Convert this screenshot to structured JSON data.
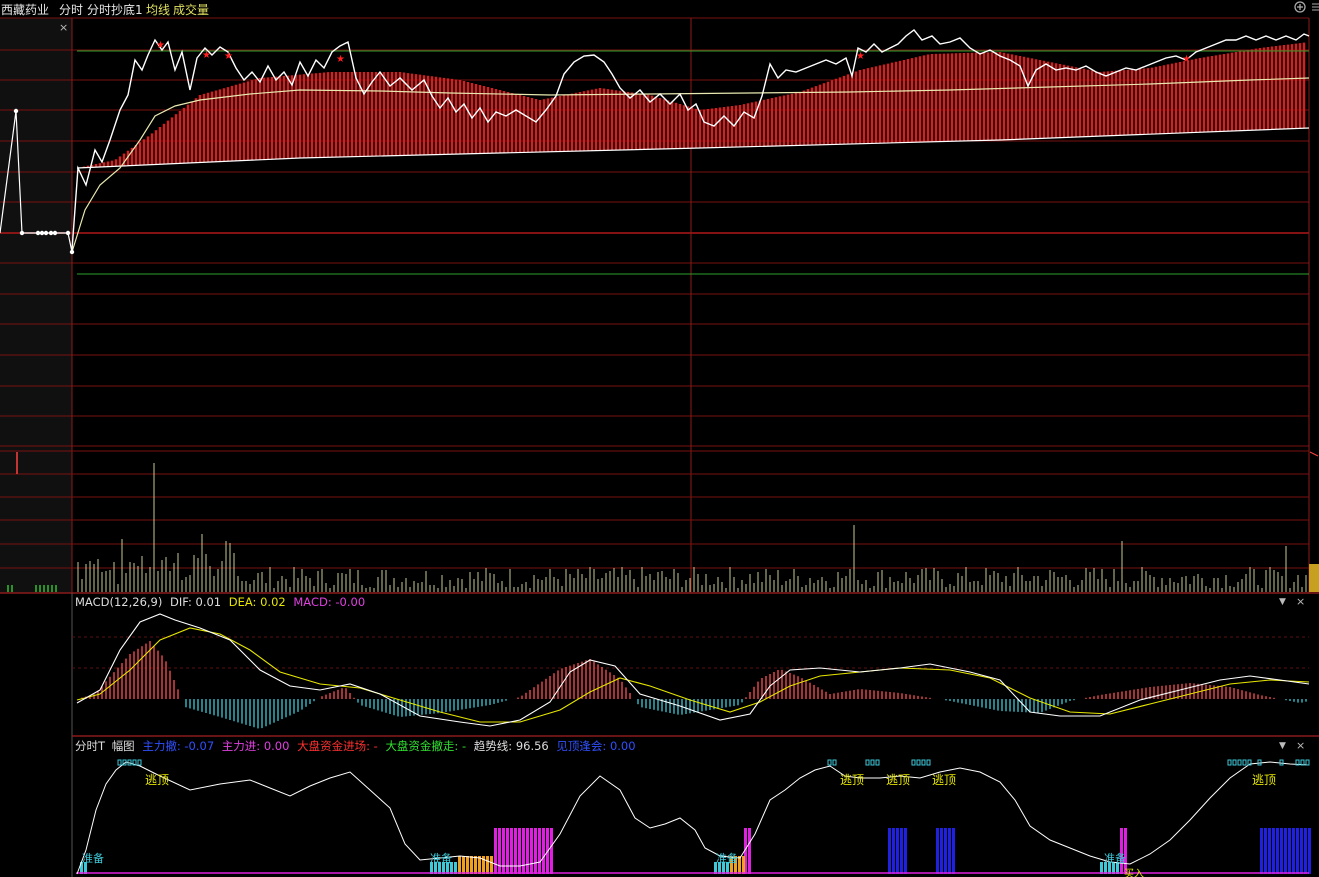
{
  "topbar": {
    "stock_name": "西藏药业",
    "tab_intraday": "分时",
    "indicator_name": "分时抄底1",
    "avg_line_label": "均线",
    "volume_label": "成交量",
    "search_icon": "search-icon",
    "menu_icon": "menu-icon"
  },
  "macd": {
    "title": "MACD(12,26,9)",
    "dif_label": "DIF:",
    "dif_value": "0.01",
    "dea_label": "DEA:",
    "dea_value": "0.02",
    "macd_label": "MACD:",
    "macd_value": "-0.00",
    "colors": {
      "dif": "#ffffff",
      "dea": "#e6e600",
      "pos": "#ff5050",
      "neg": "#3ec8d8"
    }
  },
  "bottom": {
    "title": "分时T",
    "subtitle": "幅图",
    "zlc_label": "主力撤:",
    "zlc_value": "-0.07",
    "zlj_label": "主力进:",
    "zlj_value": "0.00",
    "dpin_label": "大盘资金进场:",
    "dpin_value": "-",
    "dpout_label": "大盘资金撤走:",
    "dpout_value": "-",
    "trend_label": "趋势线:",
    "trend_value": "96.56",
    "top_label": "见顶逢会:",
    "top_value": "0.00",
    "escape_label": "逃顶",
    "prepare_label": "准备",
    "buy_label": "买入"
  },
  "controls": {
    "close_glyph": "×",
    "dropdown_glyph": "▼"
  },
  "colors": {
    "grid": "#7a1010",
    "divider": "#8c1a1a",
    "price_line": "#ffffff",
    "avg_line": "#e8e8b0",
    "bars_red": "#d42020",
    "green_ref": "#2ea02e",
    "volume": "#c8c890"
  }
}
